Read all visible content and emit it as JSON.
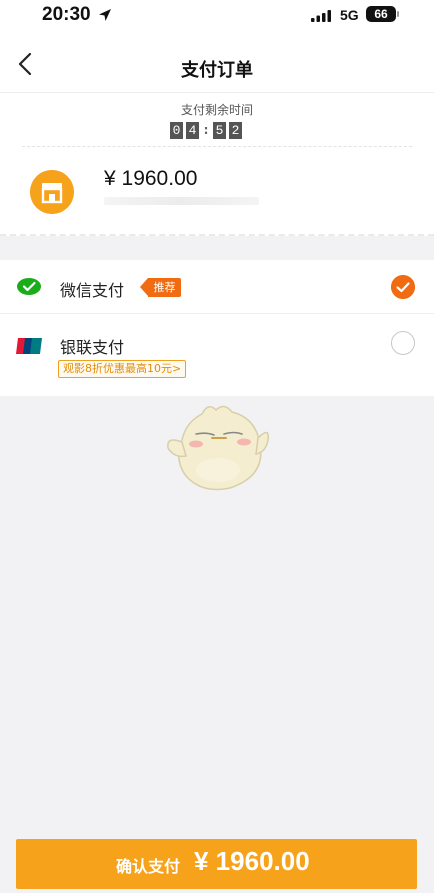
{
  "status_bar": {
    "time": "20:30",
    "network": "5G",
    "battery": "66"
  },
  "nav": {
    "title": "支付订单",
    "back_icon": "chevron-left-icon"
  },
  "order": {
    "countdown_label": "支付剩余时间",
    "countdown_digits": [
      "0",
      "4",
      "5",
      "2"
    ],
    "countdown_separator": ":",
    "shop_icon": "storefront-icon",
    "price": "¥ 1960.00"
  },
  "payment_methods": [
    {
      "label": "微信支付",
      "badge": "推荐",
      "icon": "wechat-pay-icon",
      "selected": true
    },
    {
      "label": "银联支付",
      "promo": "观影8折优惠最高10元>",
      "icon": "unionpay-icon",
      "selected": false
    }
  ],
  "confirm": {
    "label": "确认支付",
    "amount": "¥ 1960.00"
  },
  "colors": {
    "accent": "#f7a21b",
    "selected": "#f06b12",
    "wechat": "#1aad19",
    "background": "#f2f2f4"
  }
}
